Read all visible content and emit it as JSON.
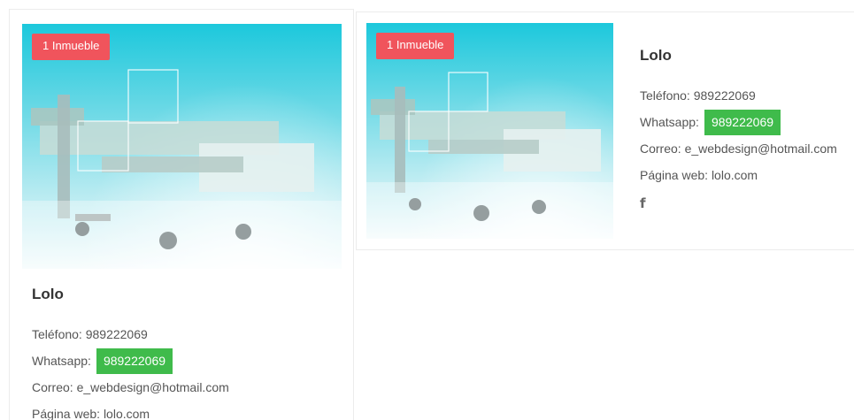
{
  "cards": [
    {
      "badge": "1 Inmueble",
      "name": "Lolo",
      "phone_label": "Teléfono: 989222069",
      "whatsapp_label": "Whatsapp:",
      "whatsapp_number": "989222069",
      "email_label": "Correo: e_webdesign@hotmail.com",
      "website_label": "Página web: lolo.com"
    },
    {
      "badge": "1 Inmueble",
      "name": "Lolo",
      "phone_label": "Teléfono: 989222069",
      "whatsapp_label": "Whatsapp:",
      "whatsapp_number": "989222069",
      "email_label": "Correo: e_webdesign@hotmail.com",
      "website_label": "Página web: lolo.com",
      "social_icon": "f"
    }
  ],
  "icons": {
    "social": "facebook-icon"
  },
  "colors": {
    "badge_bg": "#f0545c",
    "whatsapp_bg": "#3fbb4b",
    "photo_accent": "#1cc8dc"
  }
}
